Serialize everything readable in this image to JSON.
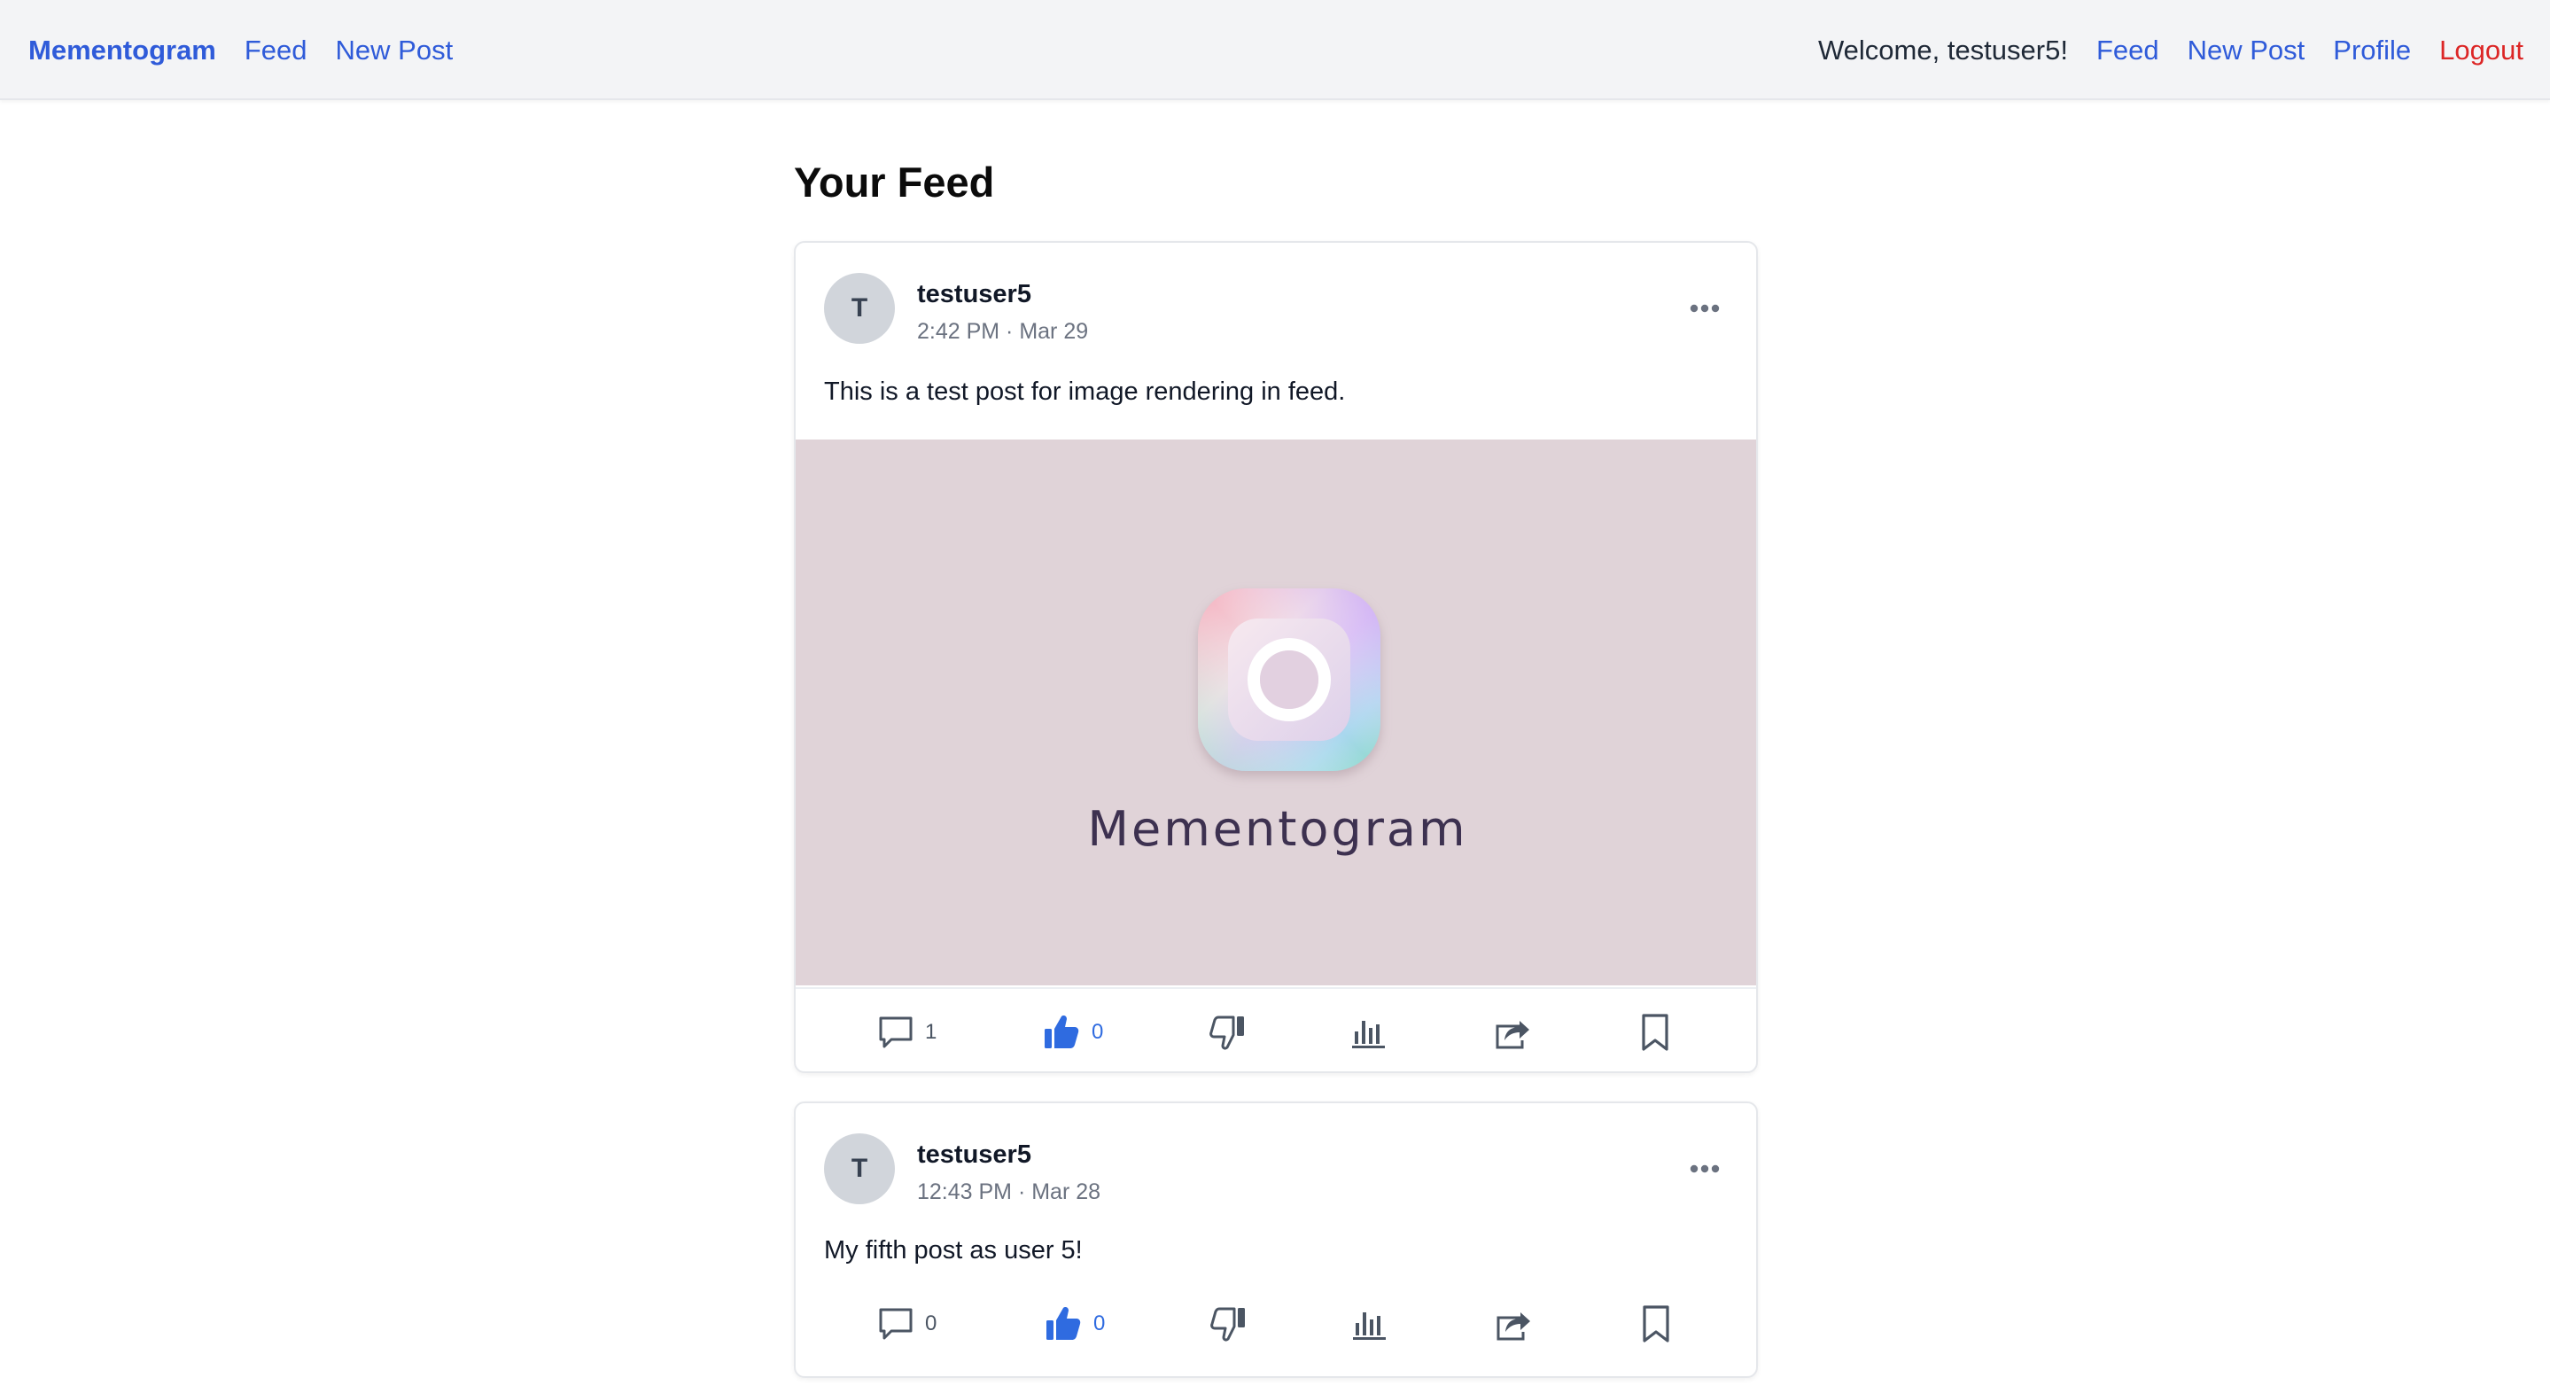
{
  "nav": {
    "brand": "Mementogram",
    "left_links": [
      "Feed",
      "New Post"
    ],
    "welcome": "Welcome, testuser5!",
    "right_links": [
      "Feed",
      "New Post",
      "Profile"
    ],
    "logout": "Logout",
    "colors": {
      "link": "#2f5bd9",
      "logout": "#dc2626",
      "background": "#f3f4f6"
    }
  },
  "main": {
    "title": "Your Feed"
  },
  "posts": [
    {
      "avatar_initial": "T",
      "username": "testuser5",
      "timestamp": "2:42 PM · Mar 29",
      "body": "This is a test post for image rendering in feed.",
      "image_caption": "Mementogram",
      "comments": "1",
      "likes": "0",
      "liked": true
    },
    {
      "avatar_initial": "T",
      "username": "testuser5",
      "timestamp": "12:43 PM · Mar 28",
      "body": "My fifth post as user 5!",
      "comments": "0",
      "likes": "0",
      "liked": true
    }
  ],
  "icons": [
    "more-horizontal-icon",
    "comment-icon",
    "thumbs-up-icon",
    "thumbs-down-icon",
    "stats-icon",
    "share-icon",
    "bookmark-icon"
  ]
}
